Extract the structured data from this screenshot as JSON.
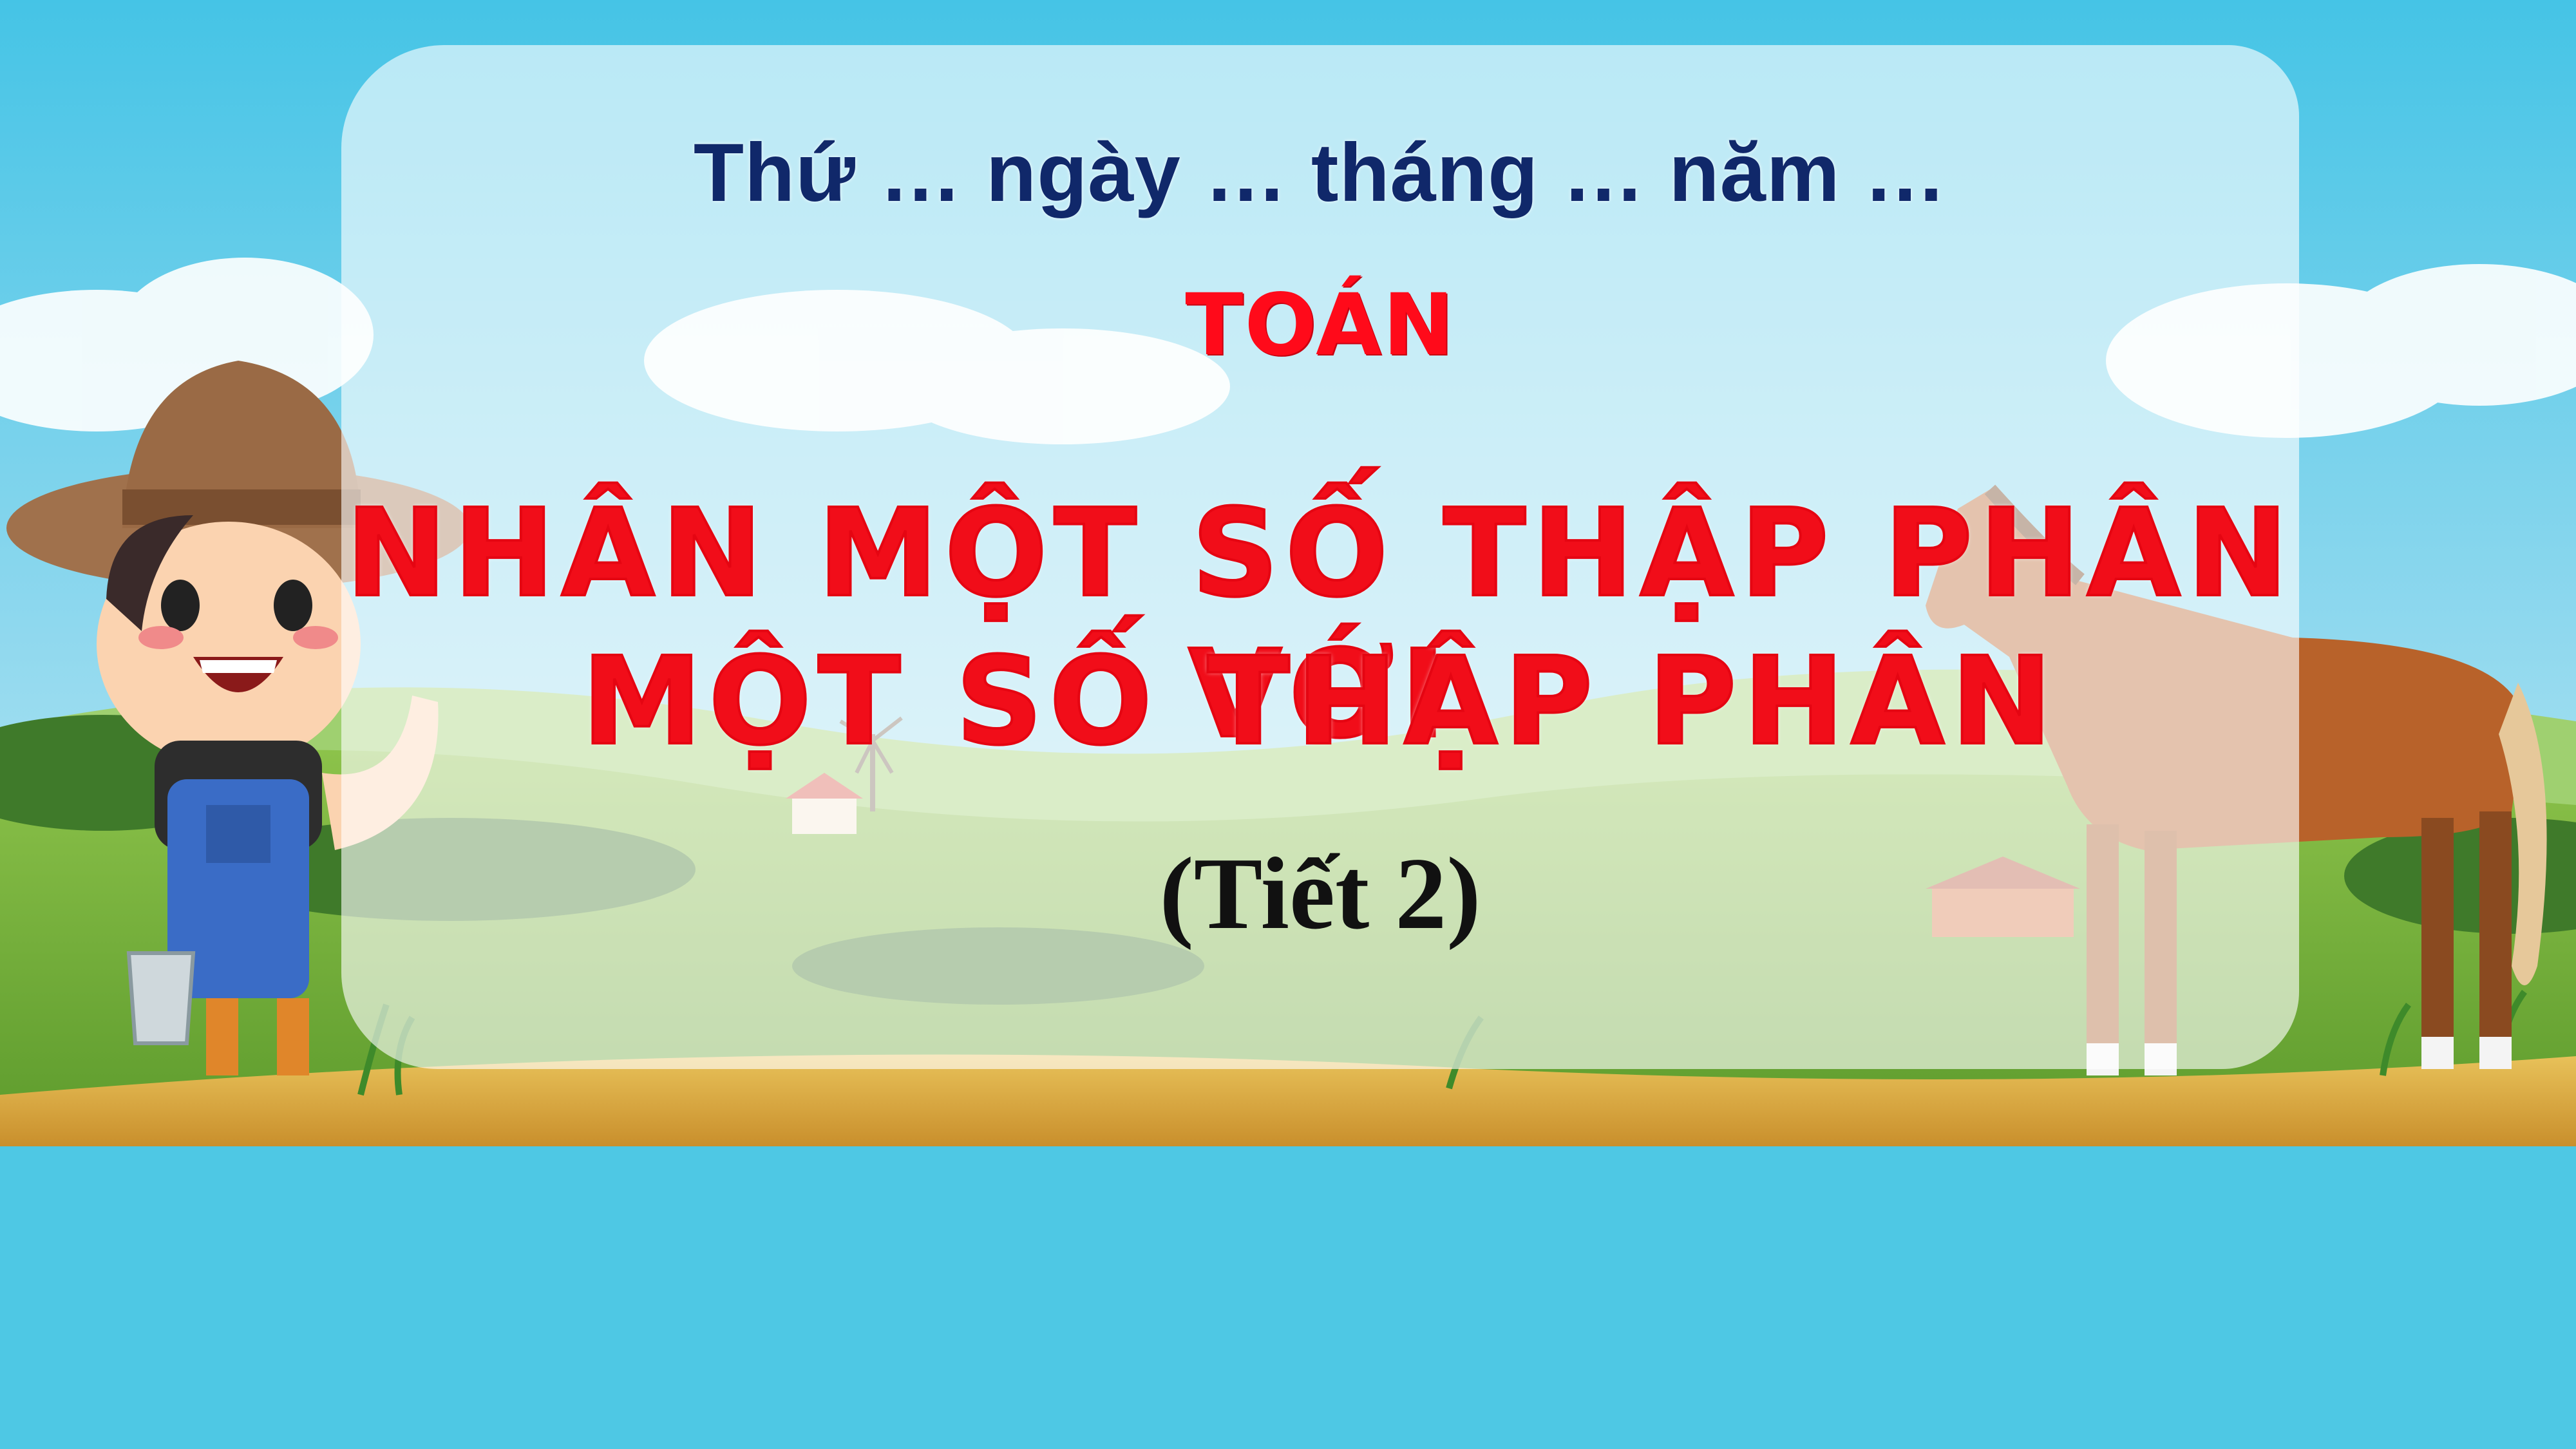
{
  "slide": {
    "date_line": "Thứ … ngày … tháng … năm …",
    "subject": "TOÁN",
    "title_line_1": "NHÂN MỘT SỐ THẬP PHÂN VỚI",
    "title_line_2": "MỘT SỐ THẬP PHÂN",
    "period": "(Tiết 2)"
  },
  "illustration": {
    "left_character": "farmer-boy-with-bucket",
    "right_animal": "horse",
    "background": "farm-landscape"
  },
  "colors": {
    "page_background": "#4ec8e4",
    "date_text": "#10286a",
    "title_red": "#f10d19",
    "period_text": "#111111"
  }
}
